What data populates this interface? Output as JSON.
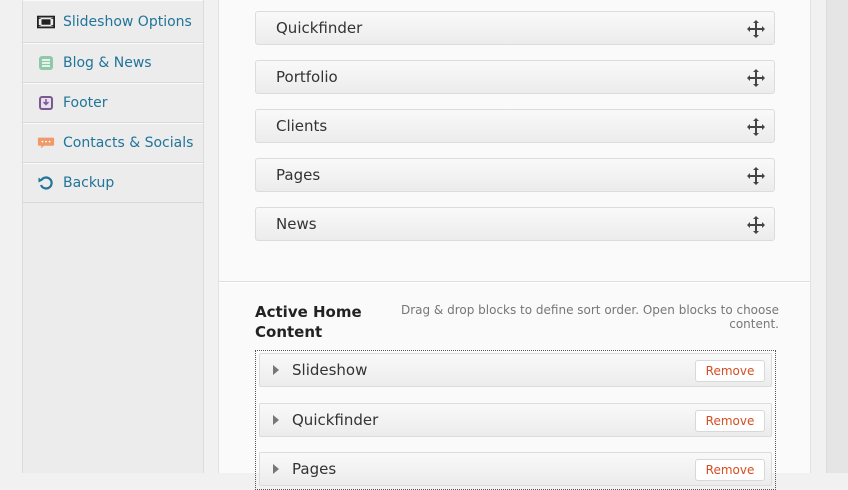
{
  "sidebar": {
    "items": [
      {
        "label": "Slideshow Options",
        "icon": "film-icon"
      },
      {
        "label": "Blog & News",
        "icon": "document-icon"
      },
      {
        "label": "Footer",
        "icon": "download-icon"
      },
      {
        "label": "Contacts & Socials",
        "icon": "speech-bubble-icon"
      },
      {
        "label": "Backup",
        "icon": "refresh-icon"
      }
    ]
  },
  "available_blocks": [
    "Quickfinder",
    "Portfolio",
    "Clients",
    "Pages",
    "News"
  ],
  "active": {
    "title": "Active Home Content",
    "hint": "Drag & drop blocks to define sort order. Open blocks to choose content.",
    "remove_label": "Remove",
    "blocks": [
      "Slideshow",
      "Quickfinder",
      "Pages"
    ]
  },
  "colors": {
    "link": "#21759b",
    "remove": "#d54e21"
  }
}
